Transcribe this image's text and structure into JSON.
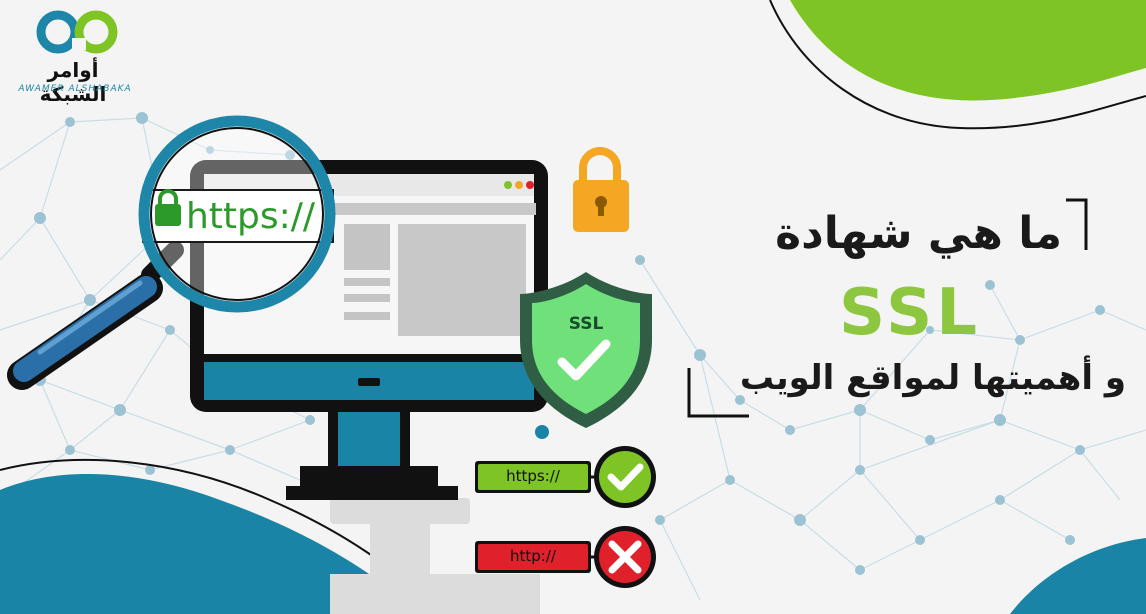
{
  "brand": {
    "name_ar": "أوامر الشبكة",
    "name_en": "AWAMER ALSHABAKA"
  },
  "illustration": {
    "address_bar_text": "https://",
    "shield_label": "SSL",
    "secure_pill_text": "https://",
    "insecure_pill_text": "http://"
  },
  "headline": {
    "line1": "ما هي شهادة",
    "line2": "SSL",
    "line3": "و أهميتها لمواقع الويب"
  },
  "colors": {
    "accent_green": "#8dc63f",
    "accent_blue": "#1e86a8",
    "secure_green": "#2b9a2a",
    "insecure_red": "#e0202a",
    "lock_orange": "#f5a623",
    "dark": "#1a1a1a"
  }
}
